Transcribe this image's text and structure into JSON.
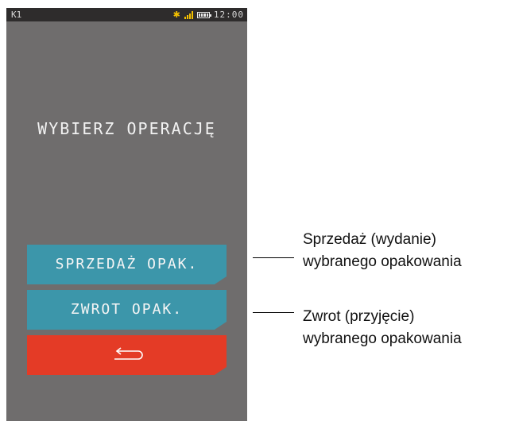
{
  "status_bar": {
    "left_label": "K1",
    "time": "12:00",
    "icons": [
      "bluetooth-icon",
      "signal-icon",
      "battery-icon"
    ],
    "accent_color": "#f3c000"
  },
  "screen": {
    "title": "WYBIERZ OPERACJĘ",
    "buttons": {
      "sale_label": "SPRZEDAŻ OPAK.",
      "return_label": "ZWROT OPAK.",
      "back_icon": "return-arrow-icon"
    },
    "colors": {
      "background": "#6f6d6d",
      "button": "#3c96aa",
      "back_button": "#e43b26"
    }
  },
  "annotations": [
    {
      "line1": "Sprzedaż (wydanie)",
      "line2": "wybranego opakowania"
    },
    {
      "line1": "Zwrot (przyjęcie)",
      "line2": "wybranego opakowania"
    }
  ]
}
